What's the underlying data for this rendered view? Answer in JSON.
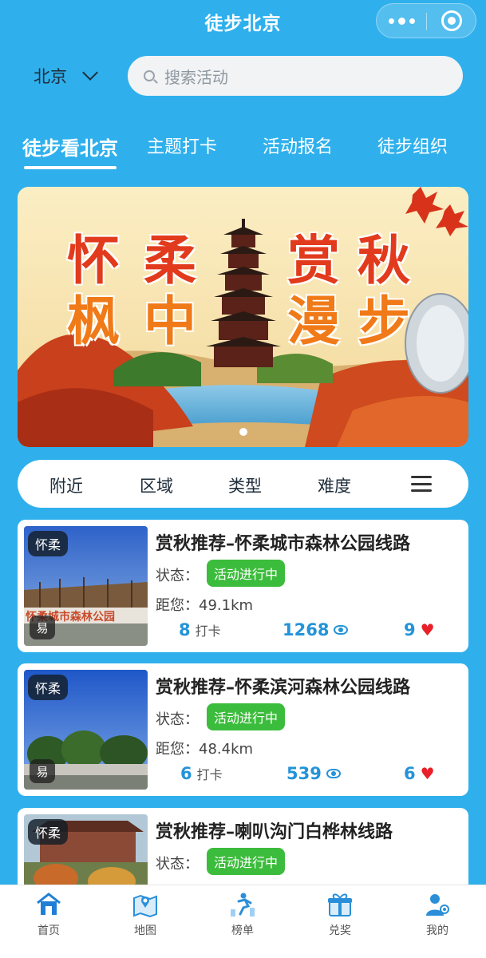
{
  "header": {
    "title": "徒步北京"
  },
  "location": {
    "city": "北京"
  },
  "search": {
    "placeholder": "搜索活动"
  },
  "tabs": [
    {
      "label": "徒步看北京",
      "active": true
    },
    {
      "label": "主题打卡",
      "active": false
    },
    {
      "label": "活动报名",
      "active": false
    },
    {
      "label": "徒步组织",
      "active": false
    }
  ],
  "banner": {
    "line1": [
      "怀",
      "柔",
      "赏",
      "秋"
    ],
    "line2": [
      "枫",
      "中",
      "漫",
      "步"
    ],
    "slide_count": 1,
    "active_slide": 1
  },
  "filters": [
    {
      "label": "附近"
    },
    {
      "label": "区域"
    },
    {
      "label": "类型"
    },
    {
      "label": "难度"
    }
  ],
  "cards": [
    {
      "region": "怀柔",
      "difficulty": "易",
      "title": "赏秋推荐–怀柔城市森林公园线路",
      "status_label": "状态：",
      "status": "活动进行中",
      "distance_label": "距您：49.1km",
      "checkins": "8",
      "checkins_label": "打卡",
      "views": "1268",
      "likes": "9",
      "thumb_text": "怀柔城市森林公园"
    },
    {
      "region": "怀柔",
      "difficulty": "易",
      "title": "赏秋推荐–怀柔滨河森林公园线路",
      "status_label": "状态：",
      "status": "活动进行中",
      "distance_label": "距您：48.4km",
      "checkins": "6",
      "checkins_label": "打卡",
      "views": "539",
      "likes": "6"
    },
    {
      "region": "怀柔",
      "title": "赏秋推荐–喇叭沟门白桦林线路",
      "status_label": "状态：",
      "status": "活动进行中"
    }
  ],
  "bottom_nav": [
    {
      "label": "首页",
      "icon": "home-icon",
      "active": true
    },
    {
      "label": "地图",
      "icon": "map-icon",
      "active": false
    },
    {
      "label": "榜单",
      "icon": "ranking-icon",
      "active": false
    },
    {
      "label": "兑奖",
      "icon": "gift-icon",
      "active": false
    },
    {
      "label": "我的",
      "icon": "profile-icon",
      "active": false
    }
  ],
  "colors": {
    "background": "#2fb0ec",
    "accent": "#2493d8",
    "status_green": "#3cbc3c",
    "heart_red": "#e8202a"
  }
}
